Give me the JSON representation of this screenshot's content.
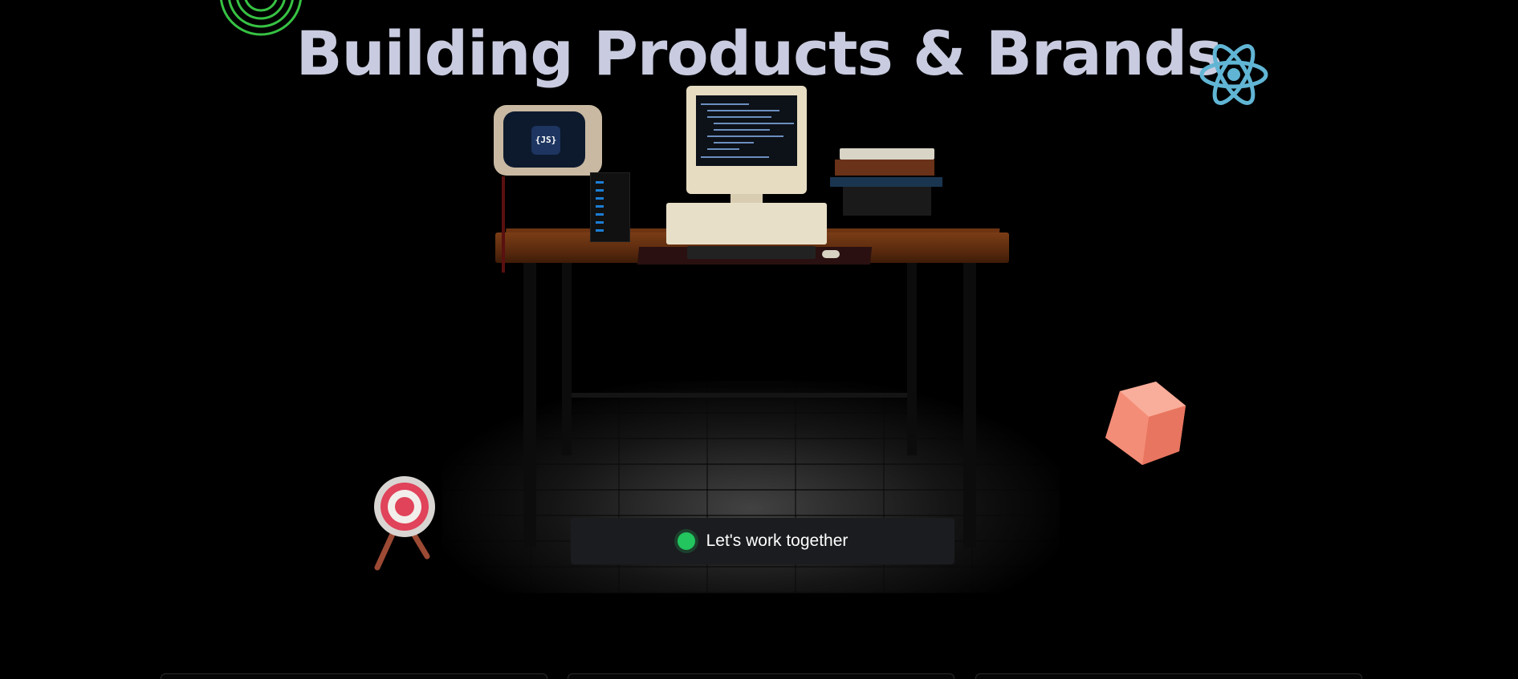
{
  "hero": {
    "headline": "Building Products & Brands"
  },
  "scene": {
    "tv_logo_text": "{JS}"
  },
  "cta": {
    "label": "Let's work together",
    "status_color": "#22c55e"
  },
  "decorations": {
    "rings_icon": "concentric-rings-icon",
    "react_icon": "react-atom-icon",
    "cube_icon": "cube-icon",
    "target_icon": "target-icon"
  },
  "colors": {
    "background": "#000000",
    "headline": "#c9cce0",
    "react": "#61b5d4",
    "cube": "#f4907a",
    "target_red": "#e0435a",
    "rings": "#37c243",
    "button_bg": "#1b1c1f"
  }
}
